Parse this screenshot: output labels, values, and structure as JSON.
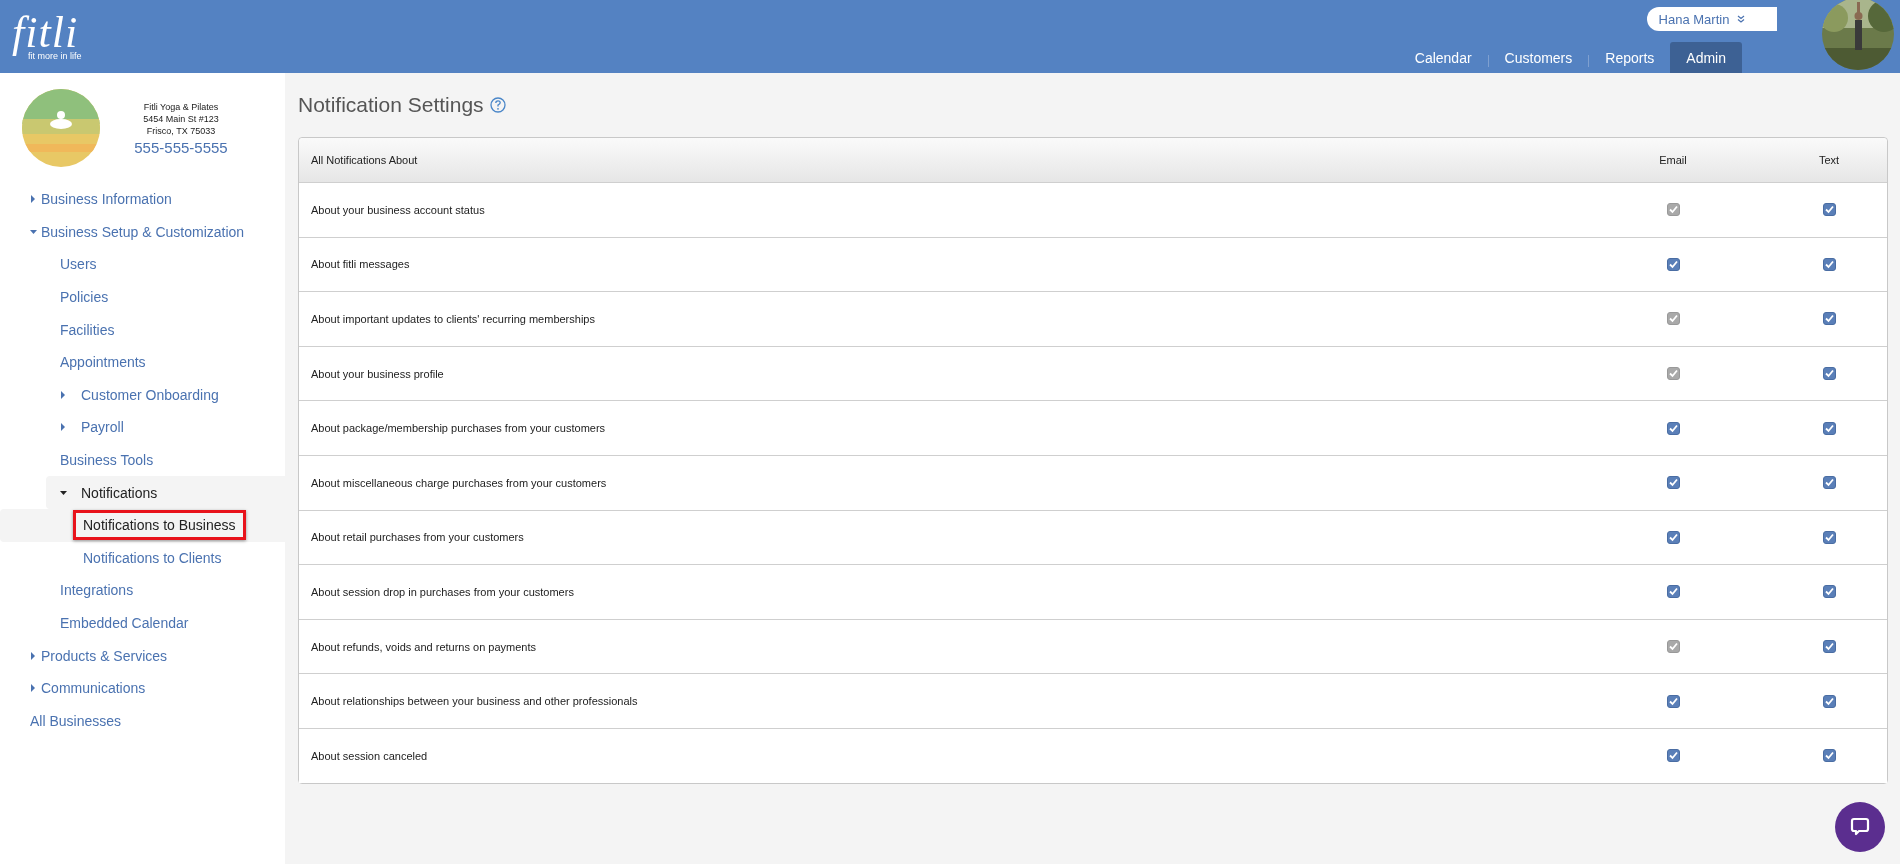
{
  "header": {
    "logo": "fitli",
    "tagline": "fit more in life",
    "user": {
      "name": "Hana Martin"
    },
    "tabs": [
      {
        "label": "Calendar",
        "selected": false
      },
      {
        "label": "Customers",
        "selected": false
      },
      {
        "label": "Reports",
        "selected": false
      },
      {
        "label": "Admin",
        "selected": true
      }
    ]
  },
  "business": {
    "name": "Fitli Yoga & Pilates",
    "address": "5454 Main St #123",
    "city": "Frisco, TX 75033",
    "phone": "555-555-5555"
  },
  "sidebar": {
    "items": [
      {
        "label": "Business Information",
        "expanded": false,
        "selected": false
      },
      {
        "label": "Business Setup & Customization",
        "expanded": true,
        "selected": false,
        "children": [
          {
            "label": "Users",
            "selected": false
          },
          {
            "label": "Policies",
            "selected": false
          },
          {
            "label": "Facilities",
            "selected": false
          },
          {
            "label": "Appointments",
            "selected": false
          },
          {
            "label": "Customer Onboarding",
            "expanded": false,
            "selected": false
          },
          {
            "label": "Payroll",
            "expanded": false,
            "selected": false
          },
          {
            "label": "Business Tools",
            "selected": false
          },
          {
            "label": "Notifications",
            "expanded": true,
            "selected": false,
            "children": [
              {
                "label": "Notifications to Business",
                "selected": true
              },
              {
                "label": "Notifications to Clients",
                "selected": false
              }
            ]
          },
          {
            "label": "Integrations",
            "selected": false
          },
          {
            "label": "Embedded Calendar",
            "selected": false
          }
        ]
      },
      {
        "label": "Products & Services",
        "expanded": false,
        "selected": false
      },
      {
        "label": "Communications",
        "expanded": false,
        "selected": false
      },
      {
        "label": "All Businesses",
        "selected": false
      }
    ]
  },
  "page": {
    "title": "Notification Settings"
  },
  "table": {
    "columns": [
      "All Notifications About",
      "Email",
      "Text"
    ],
    "rows": [
      {
        "label": "About your business account status",
        "email": {
          "checked": true,
          "disabled": true
        },
        "text": {
          "checked": true,
          "disabled": false
        }
      },
      {
        "label": "About fitli messages",
        "email": {
          "checked": true,
          "disabled": false
        },
        "text": {
          "checked": true,
          "disabled": false
        }
      },
      {
        "label": "About important updates to clients' recurring memberships",
        "email": {
          "checked": true,
          "disabled": true
        },
        "text": {
          "checked": true,
          "disabled": false
        }
      },
      {
        "label": "About your business profile",
        "email": {
          "checked": true,
          "disabled": true
        },
        "text": {
          "checked": true,
          "disabled": false
        }
      },
      {
        "label": "About package/membership purchases from your customers",
        "email": {
          "checked": true,
          "disabled": false
        },
        "text": {
          "checked": true,
          "disabled": false
        }
      },
      {
        "label": "About miscellaneous charge purchases from your customers",
        "email": {
          "checked": true,
          "disabled": false
        },
        "text": {
          "checked": true,
          "disabled": false
        }
      },
      {
        "label": "About retail purchases from your customers",
        "email": {
          "checked": true,
          "disabled": false
        },
        "text": {
          "checked": true,
          "disabled": false
        }
      },
      {
        "label": "About session drop in purchases from your customers",
        "email": {
          "checked": true,
          "disabled": false
        },
        "text": {
          "checked": true,
          "disabled": false
        }
      },
      {
        "label": "About refunds, voids and returns on payments",
        "email": {
          "checked": true,
          "disabled": true
        },
        "text": {
          "checked": true,
          "disabled": false
        }
      },
      {
        "label": "About relationships between your business and other professionals",
        "email": {
          "checked": true,
          "disabled": false
        },
        "text": {
          "checked": true,
          "disabled": false
        }
      },
      {
        "label": "About session canceled",
        "email": {
          "checked": true,
          "disabled": false
        },
        "text": {
          "checked": true,
          "disabled": false
        }
      }
    ]
  }
}
